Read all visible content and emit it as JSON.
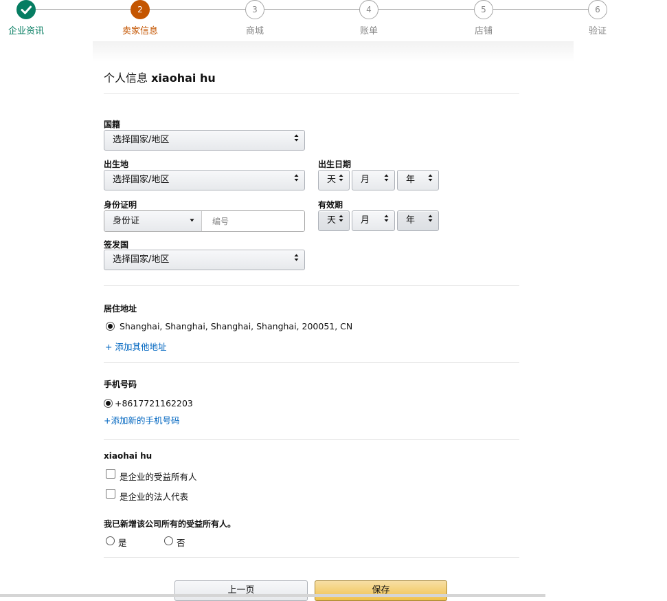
{
  "stepper": {
    "steps": [
      {
        "label": "企业资讯",
        "number": "",
        "state": "done"
      },
      {
        "label": "卖家信息",
        "number": "2",
        "state": "active"
      },
      {
        "label": "商城",
        "number": "3",
        "state": "pending"
      },
      {
        "label": "账单",
        "number": "4",
        "state": "pending"
      },
      {
        "label": "店铺",
        "number": "5",
        "state": "pending"
      },
      {
        "label": "验证",
        "number": "6",
        "state": "pending"
      }
    ],
    "colors": {
      "done": "#067d62",
      "active": "#c45500",
      "pending": "#a6a6a6"
    }
  },
  "form": {
    "title_prefix": "个人信息",
    "title_name": "xiaohai hu",
    "nationality": {
      "label": "国籍",
      "value": "选择国家/地区"
    },
    "birthplace": {
      "label": "出生地",
      "value": "选择国家/地区"
    },
    "birthdate": {
      "label": "出生日期",
      "day": "天",
      "month": "月",
      "year": "年"
    },
    "id_proof": {
      "label": "身份证明",
      "type": "身份证",
      "number_placeholder": "编号"
    },
    "expiry": {
      "label": "有效期",
      "day": "天",
      "month": "月",
      "year": "年"
    },
    "issuing_country": {
      "label": "签发国",
      "value": "选择国家/地区"
    },
    "address": {
      "label": "居住地址",
      "value": "Shanghai, Shanghai, Shanghai, Shanghai, 200051, CN",
      "add_link": "+ 添加其他地址"
    },
    "phone": {
      "label": "手机号码",
      "value": "+8617721162203",
      "add_link": "+添加新的手机号码"
    },
    "person": {
      "name": "xiaohai hu",
      "beneficial_owner": "是企业的受益所有人",
      "legal_rep": "是企业的法人代表"
    },
    "all_owners_question": {
      "label": "我已新增该公司所有的受益所有人。",
      "yes": "是",
      "no": "否"
    }
  },
  "buttons": {
    "prev": "上一页",
    "save": "保存"
  }
}
